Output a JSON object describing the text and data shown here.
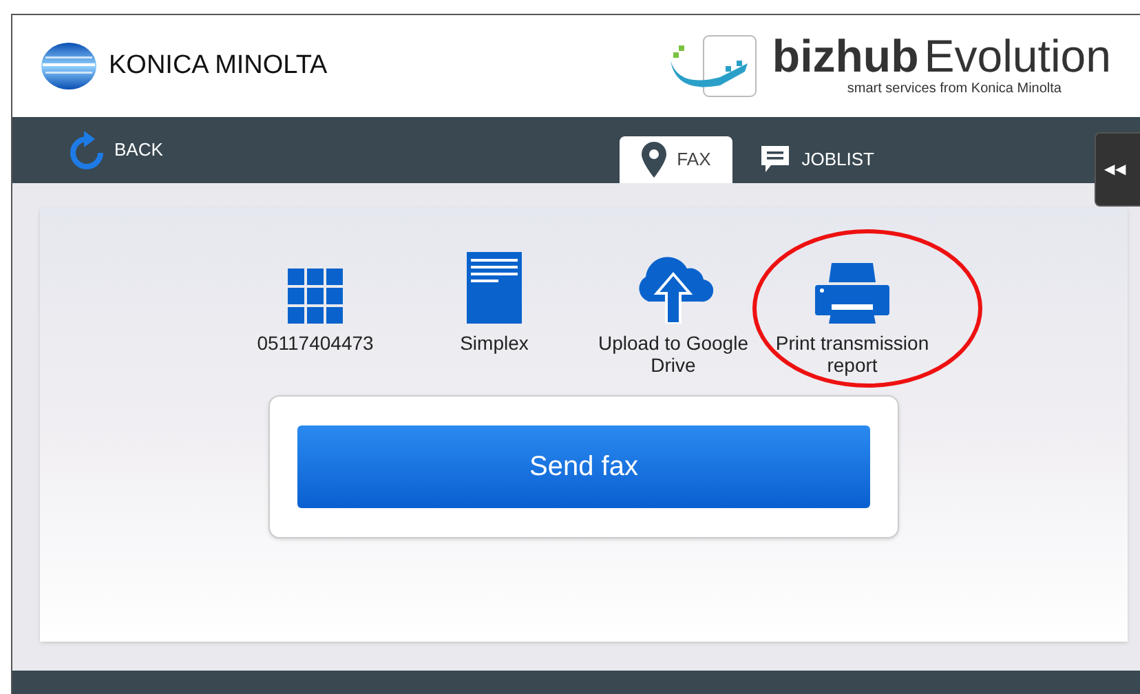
{
  "header": {
    "brand": "KONICA MINOLTA",
    "product": "bizhub",
    "product_suffix": "Evolution",
    "tagline": "smart services from Konica Minolta"
  },
  "nav": {
    "back": "BACK",
    "tabs": [
      {
        "label": "FAX",
        "kind": "pin",
        "selected": true
      },
      {
        "label": "JOBLIST",
        "kind": "chat",
        "selected": false
      }
    ],
    "collapse": "◀◀"
  },
  "options": [
    {
      "kind": "keypad",
      "label": "05117404473",
      "highlighted": false
    },
    {
      "kind": "page",
      "label": "Simplex",
      "highlighted": false
    },
    {
      "kind": "cloud",
      "label": "Upload to Google Drive",
      "highlighted": false
    },
    {
      "kind": "printer",
      "label": "Print transmission report",
      "highlighted": true
    }
  ],
  "send_button": "Send fax"
}
